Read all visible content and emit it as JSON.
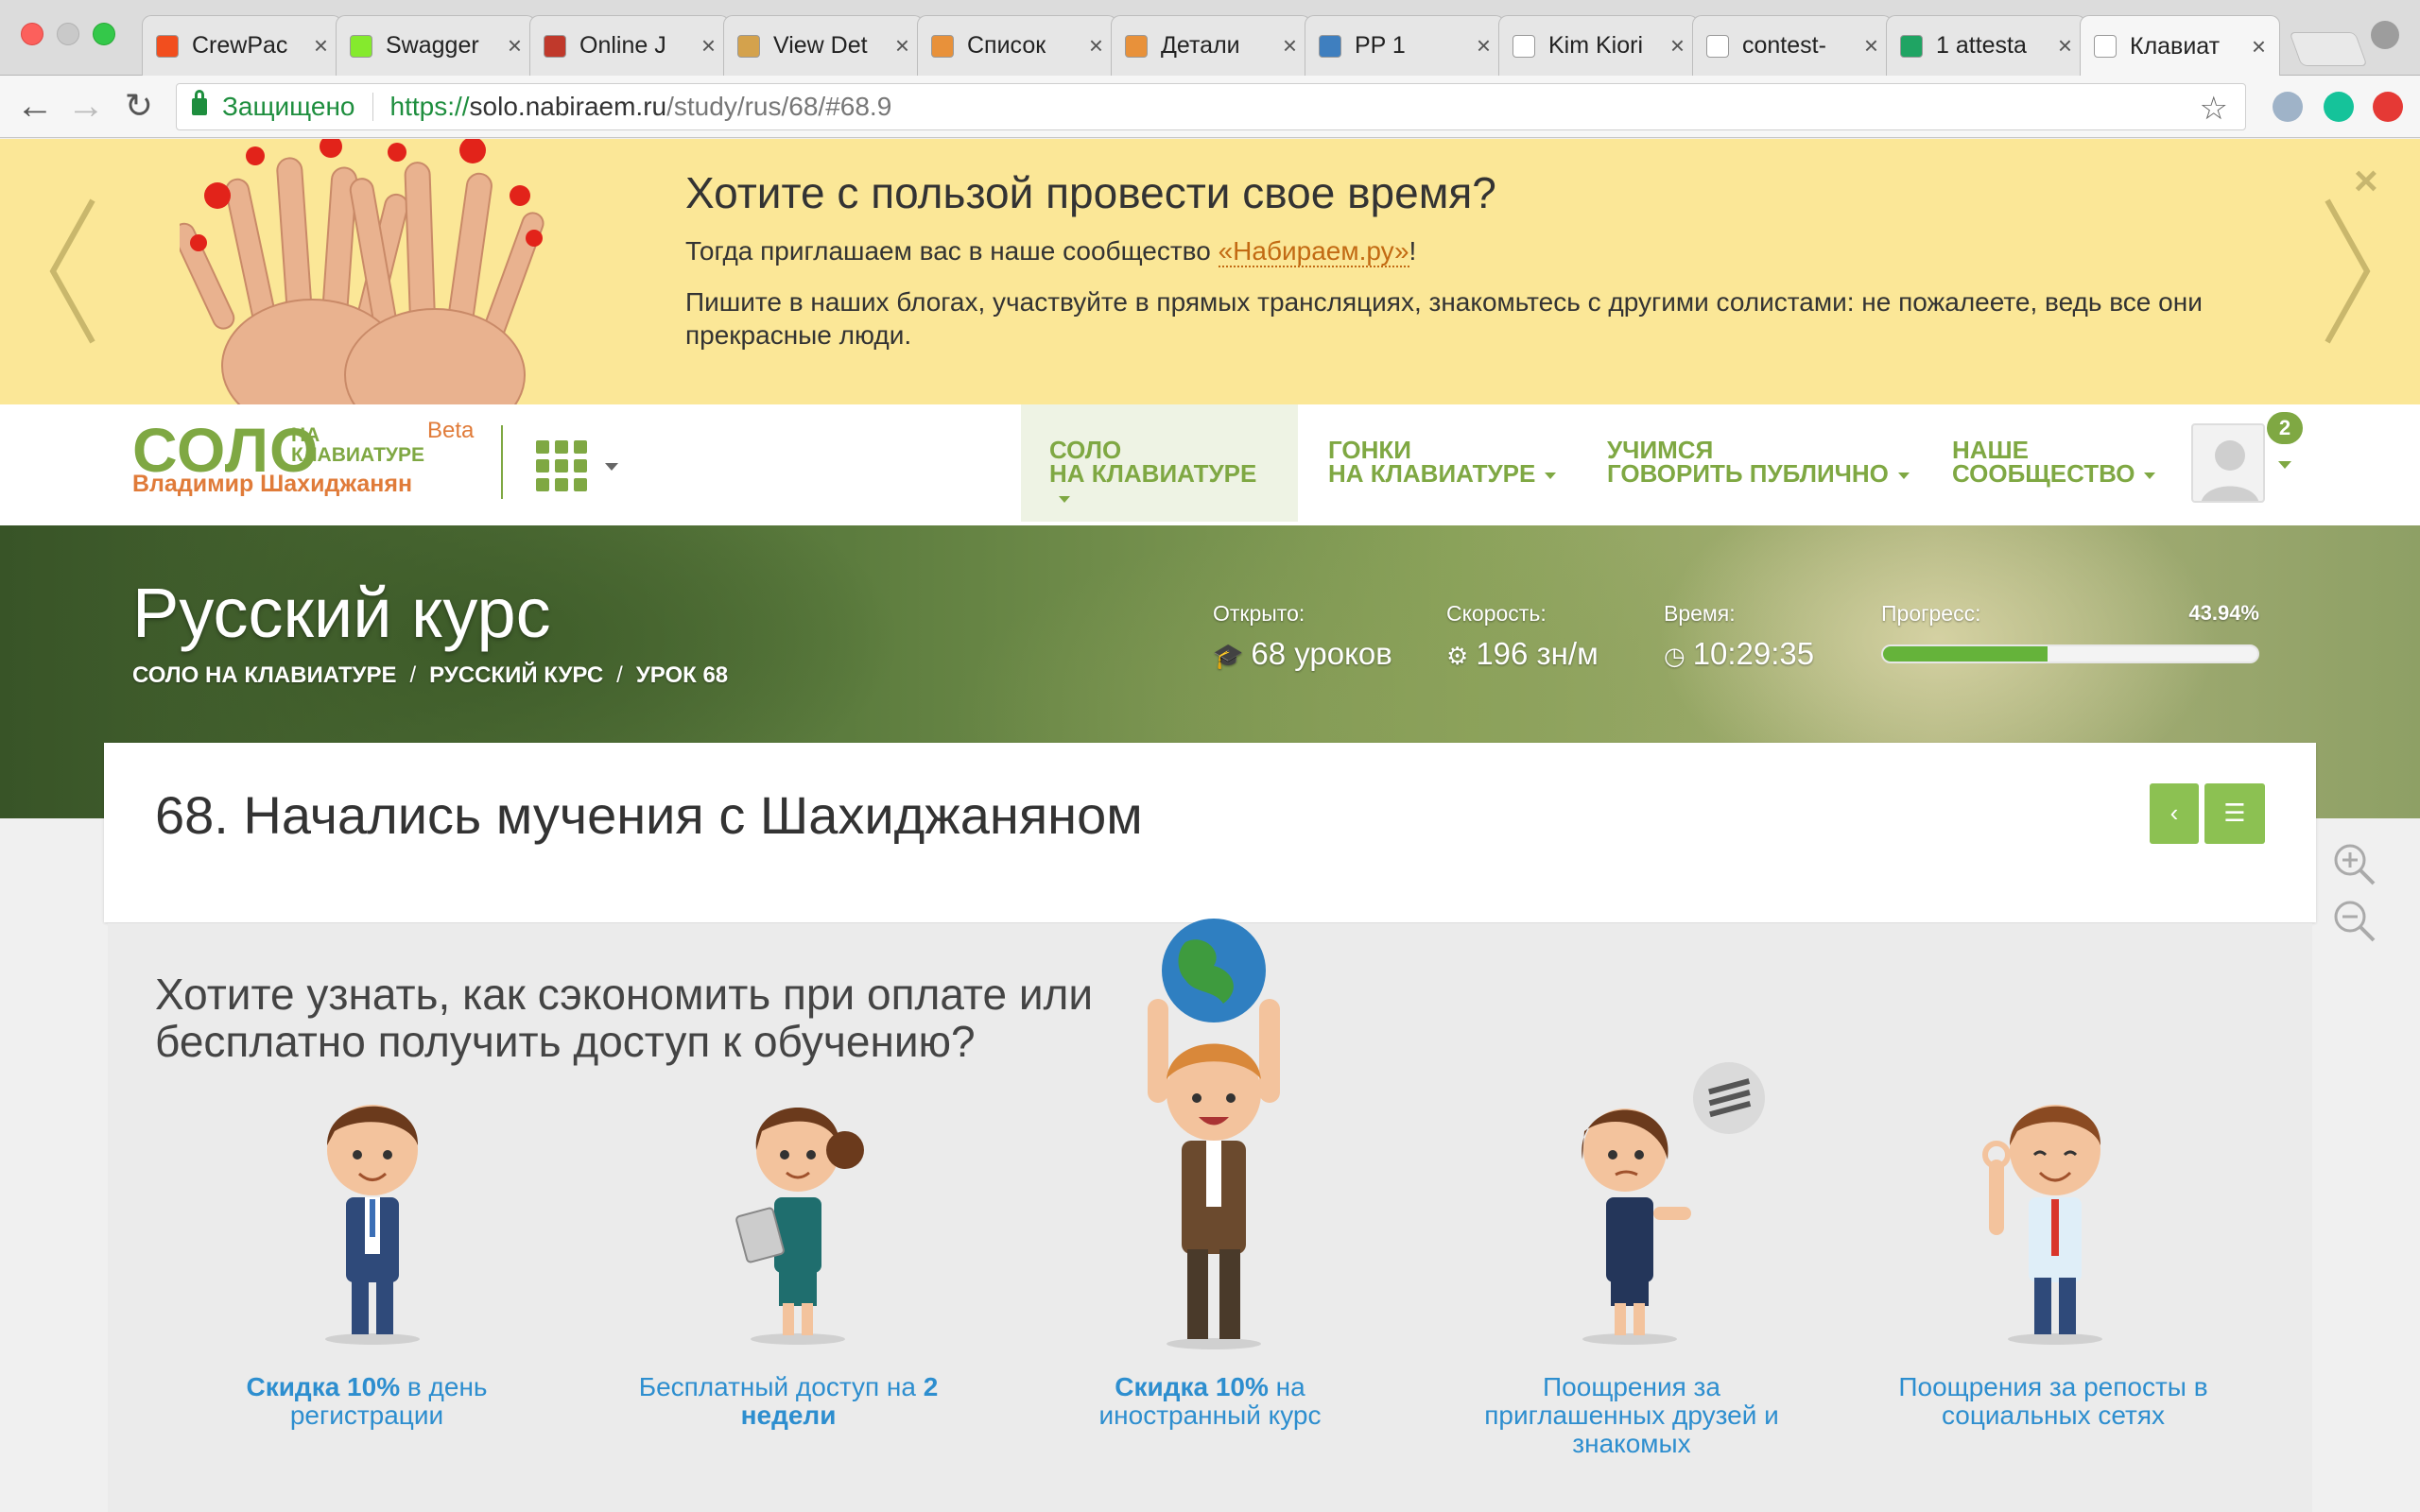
{
  "browser": {
    "tabs": [
      {
        "title": "CrewPac",
        "fav_color": "#f24e1e"
      },
      {
        "title": "Swagger",
        "fav_color": "#85ea2d"
      },
      {
        "title": "Online J",
        "fav_color": "#c0392b"
      },
      {
        "title": "View Det",
        "fav_color": "#d4a24c"
      },
      {
        "title": "Список",
        "fav_color": "#e8913a"
      },
      {
        "title": "Детали",
        "fav_color": "#e8913a"
      },
      {
        "title": "PP 1",
        "fav_color": "#3f7fbf"
      },
      {
        "title": "Kim Kiori",
        "fav_color": "#ffffff"
      },
      {
        "title": "contest-",
        "fav_color": "#ffffff"
      },
      {
        "title": "1 attesta",
        "fav_color": "#1fa463"
      },
      {
        "title": "Клавиат",
        "fav_color": "#ffffff"
      }
    ],
    "close_glyph": "×",
    "secure_label": "Защищено",
    "url_proto": "https://",
    "url_host": "solo.nabiraem.ru",
    "url_path": "/study/rus/68/#68.9"
  },
  "promo": {
    "title": "Хотите с пользой провести свое время?",
    "line1_before": "Тогда приглашаем вас в наше сообщество ",
    "line1_link": "«Набираем.ру»",
    "line1_after": "!",
    "line2": "Пишите в наших блогах, участвуйте в прямых трансляциях, знакомьтесь с другими солистами: не пожалеете, ведь все они прекрасные люди.",
    "close": "×"
  },
  "header": {
    "logo_main": "СОЛО",
    "logo_na": "НА",
    "logo_kb": "КЛАВИАТУРЕ",
    "logo_beta": "Beta",
    "logo_author": "Владимир Шахиджанян",
    "nav": [
      {
        "line1": "СОЛО",
        "line2": "НА КЛАВИАТУРЕ",
        "active": true
      },
      {
        "line1": "ГОНКИ",
        "line2": "НА КЛАВИАТУРЕ",
        "active": false
      },
      {
        "line1": "УЧИМСЯ",
        "line2": "ГОВОРИТЬ ПУБЛИЧНО",
        "active": false
      },
      {
        "line1": "НАШЕ",
        "line2": "СООБЩЕСТВО",
        "active": false
      }
    ],
    "notifications": "2"
  },
  "hero": {
    "title": "Русский курс",
    "breadcrumb": [
      "СОЛО НА КЛАВИАТУРЕ",
      "РУССКИЙ КУРС",
      "УРОК 68"
    ],
    "breadcrumb_sep": "/",
    "stats": [
      {
        "label": "Открыто:",
        "value": "68 уроков",
        "icon": "graduation-cap-icon",
        "glyph": "🎓"
      },
      {
        "label": "Скорость:",
        "value": "196 зн/м",
        "icon": "speedometer-icon",
        "glyph": "⚙"
      },
      {
        "label": "Время:",
        "value": "10:29:35",
        "icon": "clock-icon",
        "glyph": "◷"
      }
    ],
    "progress_label": "Прогресс:",
    "progress_text": "43.94%",
    "progress_value": 0.4394
  },
  "lesson": {
    "title": "68. Начались мучения с Шахиджаняном",
    "prev_glyph": "‹",
    "list_glyph": "☰"
  },
  "offers": {
    "title": "Хотите узнать, как сэкономить при оплате или бесплатно получить доступ к обучению?",
    "items": [
      {
        "bold": "Скидка 10%",
        "text": " в день регистрации",
        "bold_first": true
      },
      {
        "bold": "2 недели",
        "text": "Бесплатный доступ на ",
        "bold_first": false
      },
      {
        "bold": "Скидка 10%",
        "text": " на иностранный курс",
        "bold_first": true
      },
      {
        "bold": "",
        "text": "Поощрения за приглашенных друзей и знакомых",
        "bold_first": false
      },
      {
        "bold": "",
        "text": "Поощрения за репосты в социальных сетях",
        "bold_first": false
      }
    ]
  },
  "colors": {
    "brand_green": "#7fa843",
    "brand_orange": "#e07b39",
    "promo_bg": "#fbe797",
    "link_blue": "#2d8ecf",
    "progress_fill": "#65b33a"
  }
}
